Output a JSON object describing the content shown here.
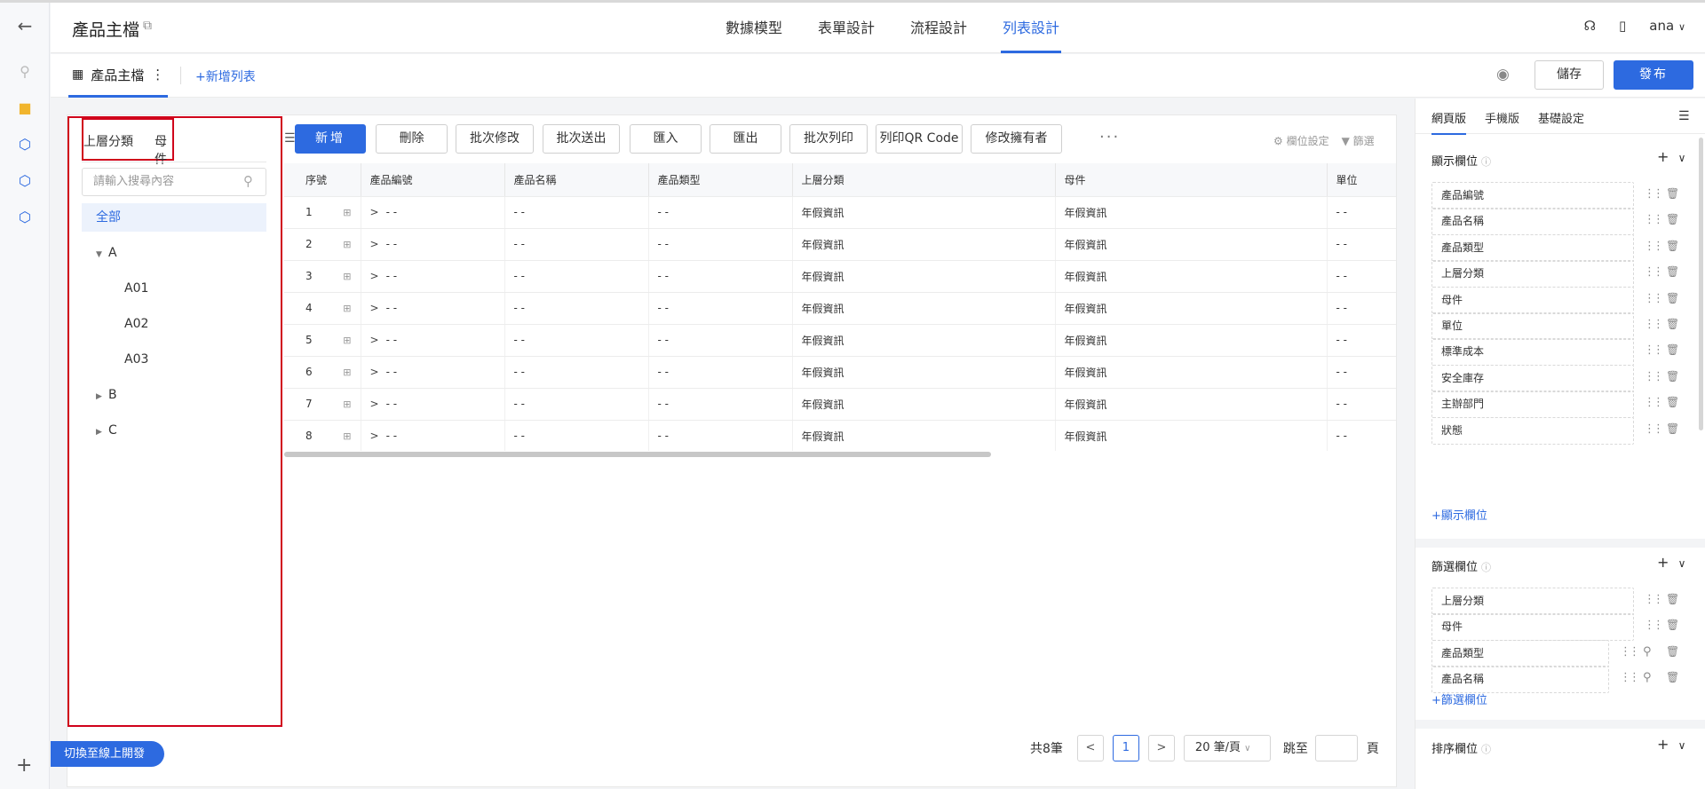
{
  "header": {
    "app_title": "產品主檔",
    "nav": [
      "數據模型",
      "表單設計",
      "流程設計",
      "列表設計"
    ],
    "user": "ana"
  },
  "subheader": {
    "list_tab": "產品主檔",
    "add_list": "新增列表",
    "save": "儲存",
    "publish": "發布"
  },
  "tree": {
    "tabs": [
      "上層分類",
      "母件"
    ],
    "search_placeholder": "請輸入搜尋內容",
    "all": "全部",
    "nodes": [
      "A",
      "A01",
      "A02",
      "A03",
      "B",
      "C"
    ]
  },
  "toolbar": {
    "buttons": [
      "新增",
      "刪除",
      "批次修改",
      "批次送出",
      "匯入",
      "匯出",
      "批次列印",
      "列印QR Code",
      "修改擁有者"
    ],
    "column_settings": "欄位設定",
    "filter": "篩選"
  },
  "table": {
    "headers": [
      "序號",
      "產品編號",
      "產品名稱",
      "產品類型",
      "上層分類",
      "母件",
      "單位"
    ],
    "rows": [
      [
        "1",
        "- -",
        "- -",
        "- -",
        "年假資訊",
        "年假資訊",
        "- -"
      ],
      [
        "2",
        "- -",
        "- -",
        "- -",
        "年假資訊",
        "年假資訊",
        "- -"
      ],
      [
        "3",
        "- -",
        "- -",
        "- -",
        "年假資訊",
        "年假資訊",
        "- -"
      ],
      [
        "4",
        "- -",
        "- -",
        "- -",
        "年假資訊",
        "年假資訊",
        "- -"
      ],
      [
        "5",
        "- -",
        "- -",
        "- -",
        "年假資訊",
        "年假資訊",
        "- -"
      ],
      [
        "6",
        "- -",
        "- -",
        "- -",
        "年假資訊",
        "年假資訊",
        "- -"
      ],
      [
        "7",
        "- -",
        "- -",
        "- -",
        "年假資訊",
        "年假資訊",
        "- -"
      ],
      [
        "8",
        "- -",
        "- -",
        "- -",
        "年假資訊",
        "年假資訊",
        "- -"
      ]
    ]
  },
  "pagination": {
    "total": "共8筆",
    "current_page": "1",
    "page_size": "20 筆/頁",
    "goto": "跳至",
    "page_unit": "頁"
  },
  "switch_button": "切換至線上開發",
  "right_panel": {
    "tabs": [
      "網頁版",
      "手機版",
      "基礎設定"
    ],
    "display_section": {
      "title": "顯示欄位",
      "fields": [
        "產品編號",
        "產品名稱",
        "產品類型",
        "上層分類",
        "母件",
        "單位",
        "標準成本",
        "安全庫存",
        "主辦部門",
        "狀態"
      ],
      "add": "顯示欄位"
    },
    "filter_section": {
      "title": "篩選欄位",
      "fields": [
        "上層分類",
        "母件",
        "產品類型",
        "產品名稱"
      ],
      "add": "篩選欄位"
    },
    "sort_section": {
      "title": "排序欄位"
    }
  },
  "colors": {
    "primary": "#2d6ae0",
    "highlight_border": "#d0021b"
  }
}
